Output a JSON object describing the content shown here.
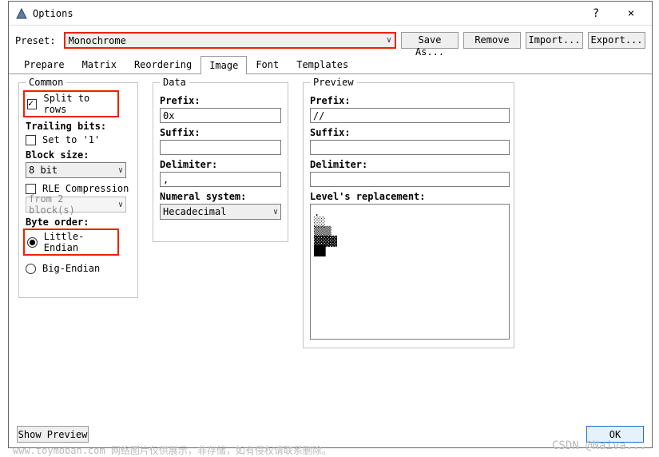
{
  "titlebar": {
    "title": "Options",
    "help": "?",
    "close": "×"
  },
  "toprow": {
    "preset_label": "Preset:",
    "preset_value": "Monochrome",
    "save_as": "Save As...",
    "remove": "Remove",
    "import": "Import...",
    "export": "Export..."
  },
  "tabs": [
    "Prepare",
    "Matrix",
    "Reordering",
    "Image",
    "Font",
    "Templates"
  ],
  "active_tab": 3,
  "common": {
    "legend": "Common",
    "split_rows": "Split to rows",
    "trailing": "Trailing bits:",
    "set_to1": "Set to '1'",
    "block_size": "Block size:",
    "block_value": "8 bit",
    "rle": "RLE Compression",
    "rle_from": "from 2 block(s)",
    "byte_order": "Byte order:",
    "le": "Little-Endian",
    "be": "Big-Endian"
  },
  "data": {
    "legend": "Data",
    "prefix": "Prefix:",
    "prefix_v": "0x",
    "suffix": "Suffix:",
    "suffix_v": "",
    "delim": "Delimiter:",
    "delim_v": ",",
    "ns": "Numeral system:",
    "ns_v": "Hecadecimal"
  },
  "preview": {
    "legend": "Preview",
    "prefix": "Prefix:",
    "prefix_v": "//",
    "suffix": "Suffix:",
    "suffix_v": "",
    "delim": "Delimiter:",
    "delim_v": "",
    "levels": "Level's replacement:"
  },
  "footer": {
    "show": "Show Preview",
    "ok": "OK"
  },
  "wm": "www.toymoban.com 网络图片仅供展示，非存储，如有侵权请联系删除。",
  "wm2": "CSDN @Naiva..."
}
